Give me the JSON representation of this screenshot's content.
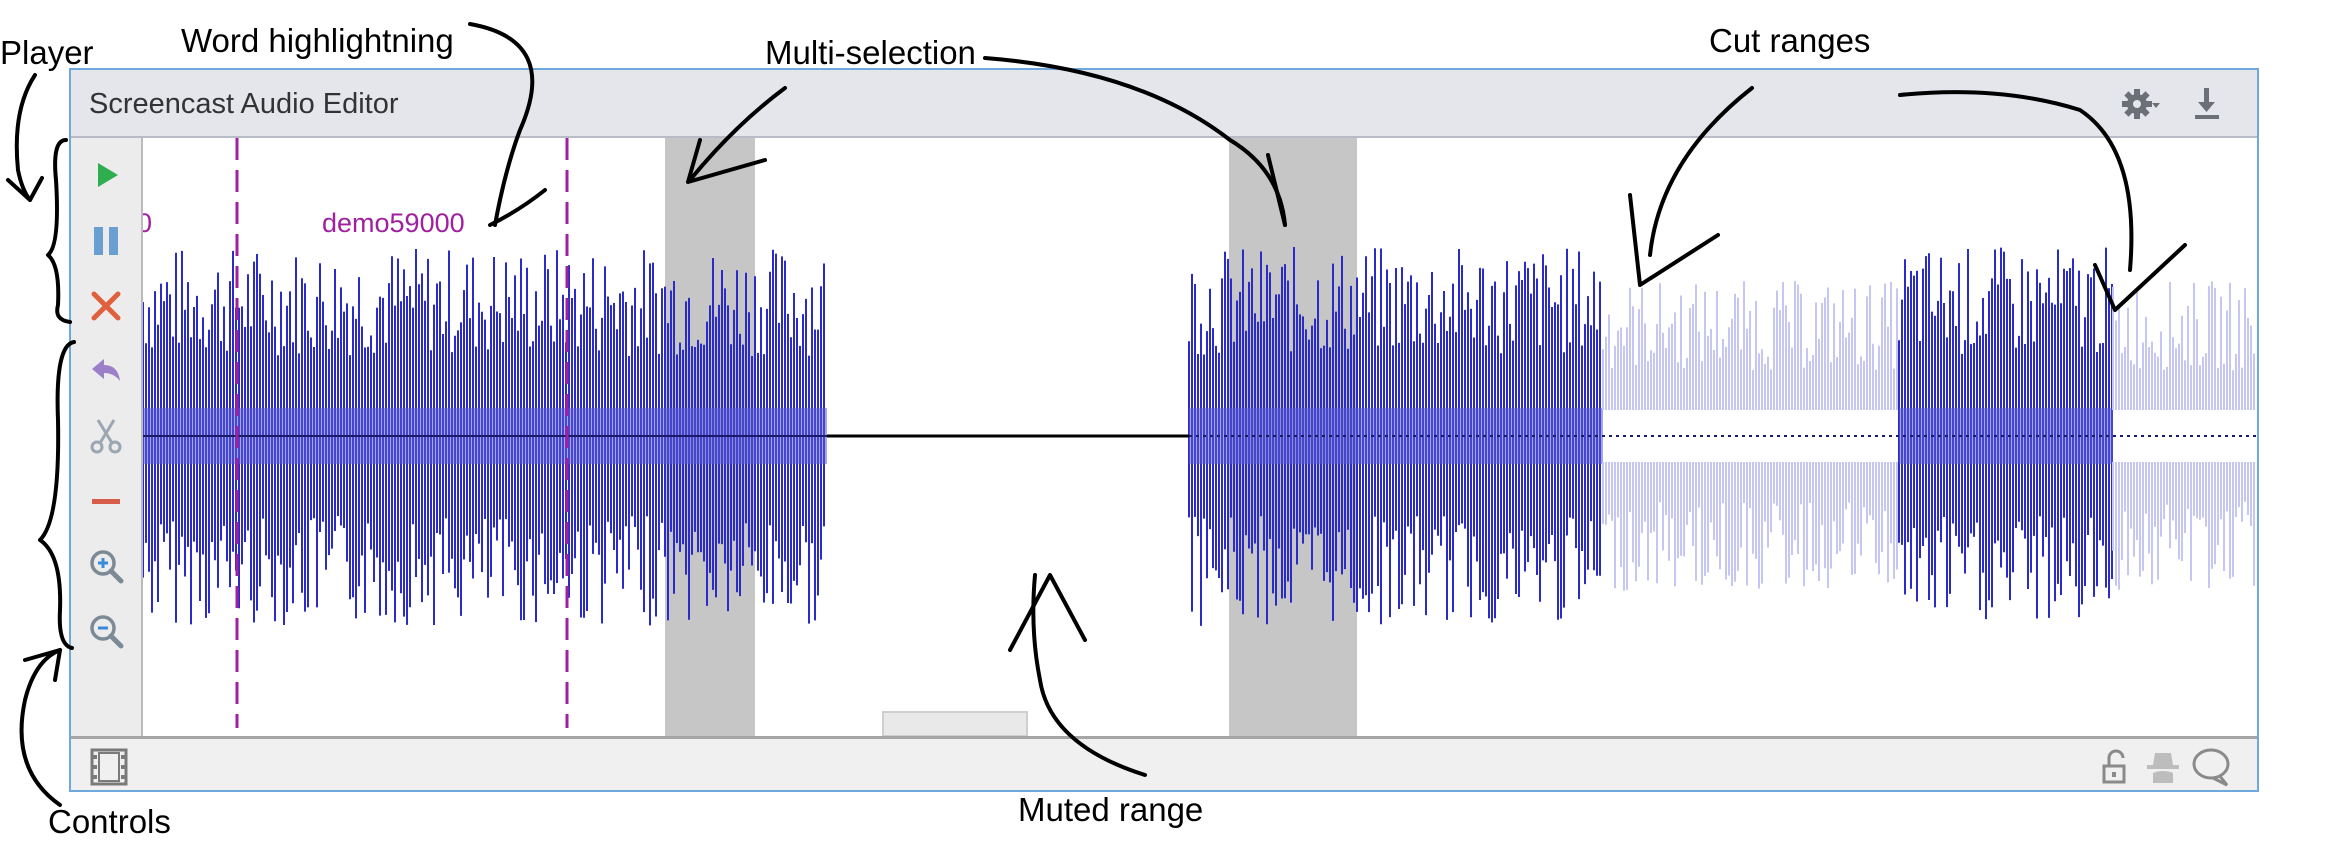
{
  "annotations": {
    "player": "Player",
    "word_highlighting": "Word highlightning",
    "multi_selection": "Multi-selection",
    "cut_ranges": "Cut ranges",
    "controls": "Controls",
    "muted_range": "Muted range"
  },
  "window": {
    "title": "Screencast Audio Editor"
  },
  "title_buttons": [
    {
      "name": "settings-gear-icon",
      "label": "settings"
    },
    {
      "name": "download-icon",
      "label": "download"
    }
  ],
  "toolbar": {
    "buttons": [
      {
        "name": "play-button",
        "icon": "play-icon",
        "color": "#2eae4f"
      },
      {
        "name": "pause-button",
        "icon": "pause-icon",
        "color": "#6a9fd2"
      },
      {
        "name": "stop-button",
        "icon": "close-icon",
        "color": "#e0603d"
      },
      {
        "name": "undo-button",
        "icon": "undo-arrow-icon",
        "color": "#9b7fc8"
      },
      {
        "name": "cut-button",
        "icon": "scissors-icon",
        "color": "#9aa7b3"
      },
      {
        "name": "mute-button",
        "icon": "minus-icon",
        "color": "#d85c4a"
      },
      {
        "name": "zoom-in-button",
        "icon": "zoom-in-icon",
        "color": "#7c8a96"
      },
      {
        "name": "zoom-out-button",
        "icon": "zoom-out-icon",
        "color": "#7c8a96"
      }
    ]
  },
  "waveform": {
    "words": [
      {
        "text": "0"
      },
      {
        "text": "demo59000"
      }
    ],
    "colors": {
      "audio": "#2b2bc8",
      "cut": "#c6c6f2",
      "selection": "#c6c6c6",
      "word": "#a020a0",
      "baseline": "#000000"
    }
  },
  "bottom_bar": {
    "buttons": [
      {
        "name": "film-strip-icon"
      },
      {
        "name": "unlock-icon"
      },
      {
        "name": "incognito-icon"
      },
      {
        "name": "speech-bubble-icon"
      }
    ]
  }
}
